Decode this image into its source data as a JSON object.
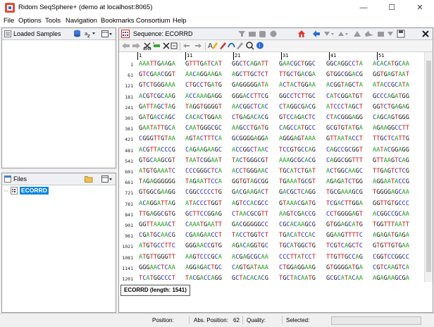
{
  "window": {
    "title": "Ridom SeqSphere+ (demo at localhost:8065)",
    "minimize": "—",
    "maximize": "☐",
    "close": "✕"
  },
  "menu": [
    "File",
    "Options",
    "Tools",
    "Navigation",
    "Bookmarks",
    "Consortium",
    "Help"
  ],
  "loaded_samples": {
    "title": "Loaded Samples"
  },
  "files": {
    "title": "Files",
    "tree_item": "ECORRD"
  },
  "sequence": {
    "title": "Sequence: ECORRD",
    "tab_label": "ECORRD (length: 1541)",
    "ruler": [
      "1",
      "11",
      "21",
      "31",
      "41",
      "51"
    ],
    "rows": [
      {
        "n": "1",
        "g": [
          "AAATTGAAGA",
          "GTTTGATCAT",
          "GGCTCAGATT",
          "GAACGCTGGC",
          "GGCAGGCCTA",
          "ACACATGCAA"
        ]
      },
      {
        "n": "61",
        "g": [
          "GTCGAACGGT",
          "AACAGGAAGA",
          "AGCTTGCTCT",
          "TTGCTGACGA",
          "GTGGCGGACG",
          "GGTGAGTAAT"
        ]
      },
      {
        "n": "121",
        "g": [
          "GTCTGGGAAA",
          "CTGCCTGATG",
          "GAGGGGGATA",
          "ACTACTGGAA",
          "ACGGTAGCTA",
          "ATACCGCATA"
        ]
      },
      {
        "n": "181",
        "g": [
          "ACGTCGCAAG",
          "ACCAAAGAGG",
          "GGGACCTTCG",
          "GGCCTCTTGC",
          "CATCGGATGT",
          "GCCCAGATGG"
        ]
      },
      {
        "n": "241",
        "g": [
          "GATTAGCTAG",
          "TAGGTGGGGT",
          "AACGGCTCAC",
          "CTAGGCGACG",
          "ATCCCTAGCT",
          "GGTCTGAGAG"
        ]
      },
      {
        "n": "301",
        "g": [
          "GATGACCAGC",
          "CACACTGGAA",
          "CTGAGACACG",
          "GTCCAGACTC",
          "CTACGGGAGG",
          "CAGCAGTGGG"
        ]
      },
      {
        "n": "361",
        "g": [
          "GAATATTGCA",
          "CAATGGGCGC",
          "AAGCCTGATG",
          "CAGCCATGCC",
          "GCGTGTATGA",
          "AGAAGGCCTT"
        ]
      },
      {
        "n": "421",
        "g": [
          "CGGGTTGTAA",
          "AGTACTTTCA",
          "GCGGGGAGGA",
          "AGGGAGTAAA",
          "GTTAATACCT",
          "TTGCTCATTG"
        ]
      },
      {
        "n": "481",
        "g": [
          "ACGTTACCCG",
          "CAGAAGAAGC",
          "ACCGGCTAAC",
          "TCCGTGCCAG",
          "CAGCCGCGGT",
          "AATACGGAGG"
        ]
      },
      {
        "n": "541",
        "g": [
          "GTGCAAGCGT",
          "TAATCGGAAT",
          "TACTGGGCGT",
          "AAAGCGCACG",
          "CAGGCGGTTT",
          "GTTAAGTCAG"
        ]
      },
      {
        "n": "601",
        "g": [
          "ATGTGAAATC",
          "CCCGGGCTCA",
          "ACCTGGGAAC",
          "TGCATCTGAT",
          "ACTGGCAAGC",
          "TTGAGTCTCG"
        ]
      },
      {
        "n": "661",
        "g": [
          "TAGAGGGGGG",
          "TAGAATTCCA",
          "GGTGTAGCGG",
          "TGAAATGCGT",
          "AGAGATCTGG",
          "AGGAATACCG"
        ]
      },
      {
        "n": "721",
        "g": [
          "GTGGCGAAGG",
          "CGGCCCCCTG",
          "GACGAAGACT",
          "GACGCTCAGG",
          "TGCGAAAGCG",
          "TGGGGAGCAA"
        ]
      },
      {
        "n": "781",
        "g": [
          "ACAGGATTAG",
          "ATACCCTGGT",
          "AGTCCACGCC",
          "GTAAACGATG",
          "TCGACTTGGA",
          "GGTTGTGCCC"
        ]
      },
      {
        "n": "841",
        "g": [
          "TTGAGGCGTG",
          "GCTTCCGGAG",
          "CTAACGCGTT",
          "AAGTCGACCG",
          "CCTGGGGAGT",
          "ACGGCCGCAA"
        ]
      },
      {
        "n": "901",
        "g": [
          "GGTTAAAACT",
          "CAAATGAATT",
          "GACGGGGGCC",
          "CGCACAAGCG",
          "GTGGAGCATG",
          "TGGTTTAATT"
        ]
      },
      {
        "n": "961",
        "g": [
          "CGATGCAACG",
          "CGAAGAACCT",
          "TACCTGGTCT",
          "TGACATCCAC",
          "GGAAGTTTTC",
          "AGAGATGAGA"
        ]
      },
      {
        "n": "1021",
        "g": [
          "ATGTGCCTTC",
          "GGGAACCGTG",
          "AGACAGGTGC",
          "TGCATGGCTG",
          "TCGTCAGCTC",
          "GTGTTGTGAA"
        ]
      },
      {
        "n": "1081",
        "g": [
          "ATGTTGGGTT",
          "AAGTCCCGCA",
          "ACGAGCGCAA",
          "CCCTTATCCT",
          "TTGTTGCCAG",
          "CGGTCCGGCC"
        ]
      },
      {
        "n": "1141",
        "g": [
          "GGGAACTCAA",
          "AGGAGACTGC",
          "CAGTGATAAA",
          "CTGGAGGAAG",
          "GTGGGGATGA",
          "CGTCAAGTCA"
        ]
      },
      {
        "n": "1201",
        "g": [
          "TCATGGCCCT",
          "TACGACCAGG",
          "GCTACACACG",
          "TGCTACAATG",
          "GCGCATACAA",
          "AGAGAAGCGA"
        ]
      },
      {
        "n": "1261",
        "g": [
          "CCTCGCGAGA",
          "GCAAGCGGAC",
          "CTCATAAAGT",
          "GCGTCGTAGT",
          "CCGGATTGGA",
          "GTCTGCAACT"
        ]
      },
      {
        "n": "1321",
        "g": [
          "CGACTCCATG",
          "AAGTCGGAAT",
          "CGCTAGTAAT",
          "CGTGGATCAG",
          "AATGCCACGG",
          "TGAATACGTT"
        ]
      }
    ]
  },
  "statusbar": {
    "position_label": "Position:",
    "abs_label": "Abs. Position:",
    "abs_value": "62",
    "quality_label": "Quality:",
    "selected_label": "Selected:"
  }
}
